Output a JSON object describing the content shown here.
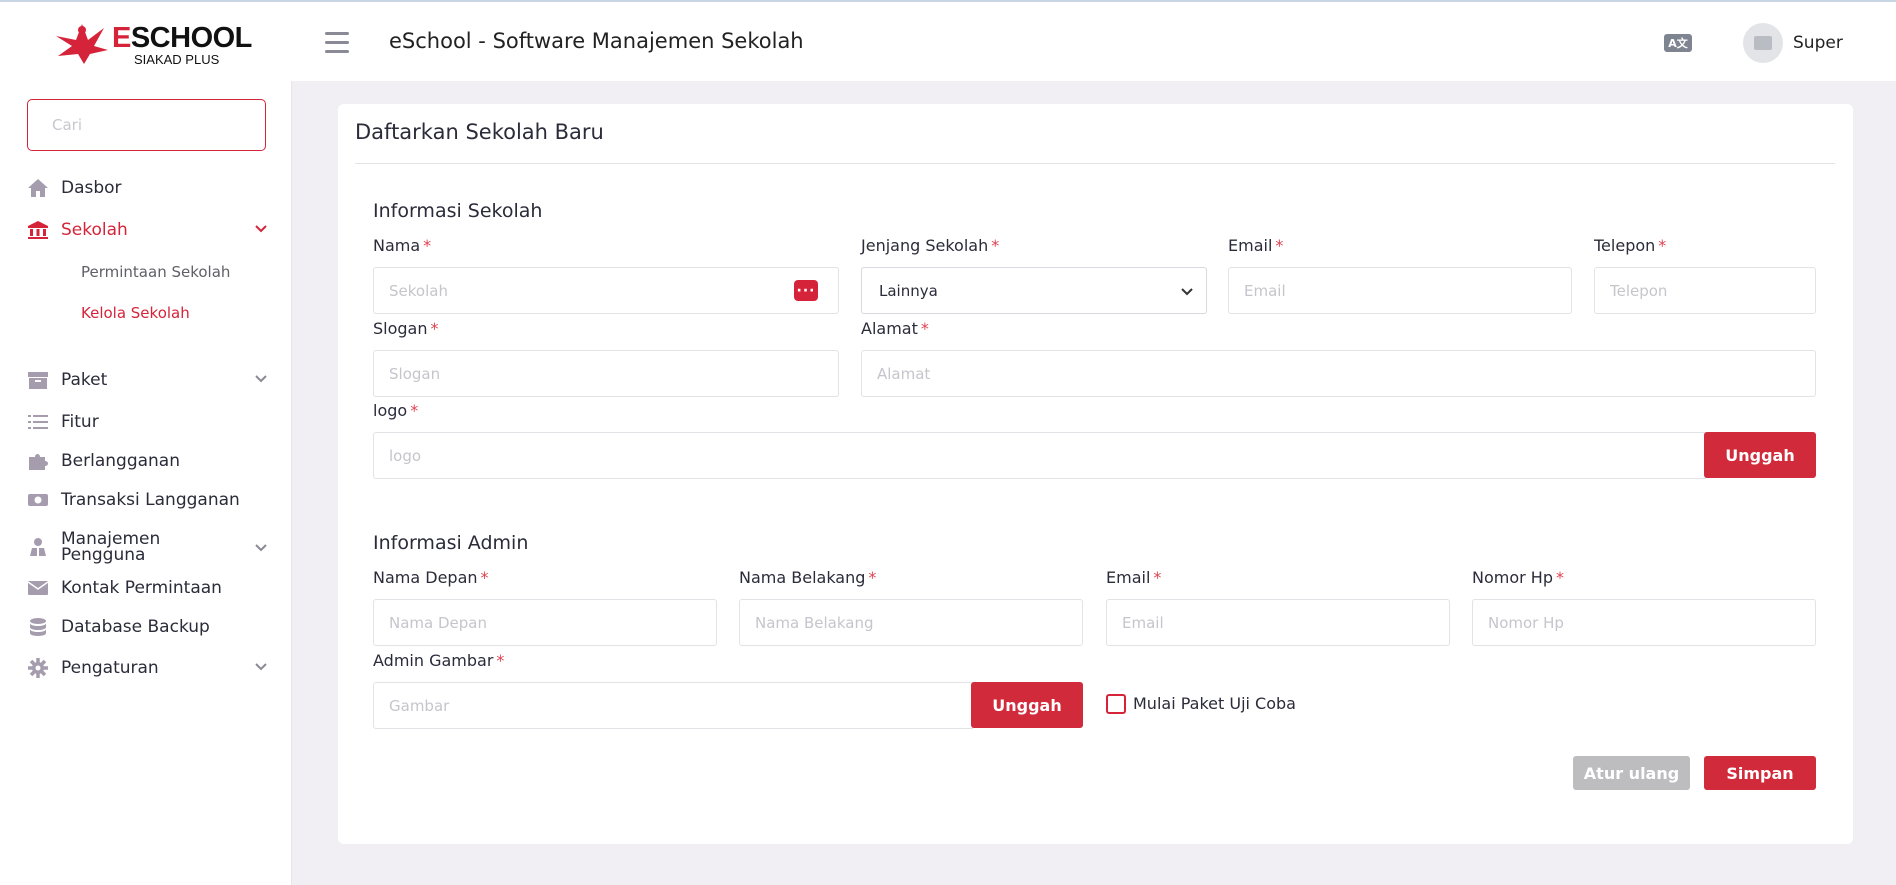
{
  "header": {
    "logo_main_e": "E",
    "logo_main_rest": "SCHOOL",
    "logo_sub": "SIAKAD PLUS",
    "app_title": "eSchool - Software Manajemen Sekolah",
    "lang_icon": "A文",
    "user_name": "Super"
  },
  "sidebar": {
    "search_placeholder": "Cari",
    "items": [
      {
        "label": "Dasbor",
        "icon": "home-icon"
      },
      {
        "label": "Sekolah",
        "icon": "bank-icon",
        "active": true,
        "expanded": true
      },
      {
        "label": "Paket",
        "icon": "archive-icon"
      },
      {
        "label": "Fitur",
        "icon": "list-icon"
      },
      {
        "label": "Berlangganan",
        "icon": "puzzle-icon"
      },
      {
        "label": "Transaksi Langganan",
        "icon": "money-icon"
      },
      {
        "label": "Manajemen Pengguna",
        "label_line1": "Manajemen",
        "label_line2": "Pengguna",
        "icon": "users-icon"
      },
      {
        "label": "Kontak Permintaan",
        "icon": "envelope-icon"
      },
      {
        "label": "Database Backup",
        "icon": "database-icon"
      },
      {
        "label": "Pengaturan",
        "icon": "gear-icon"
      }
    ],
    "sub_items": [
      {
        "label": "Permintaan Sekolah"
      },
      {
        "label": "Kelola Sekolah",
        "active": true
      }
    ]
  },
  "form": {
    "title": "Daftarkan Sekolah Baru",
    "school_section": "Informasi Sekolah",
    "name_label": "Nama",
    "name_placeholder": "Sekolah",
    "level_label": "Jenjang Sekolah",
    "level_value": "Lainnya",
    "email_label": "Email",
    "email_placeholder": "Email",
    "phone_label": "Telepon",
    "phone_placeholder": "Telepon",
    "slogan_label": "Slogan",
    "slogan_placeholder": "Slogan",
    "address_label": "Alamat",
    "address_placeholder": "Alamat",
    "logo_label": "logo",
    "logo_placeholder": "logo",
    "upload_label": "Unggah",
    "admin_section": "Informasi Admin",
    "first_name_label": "Nama Depan",
    "first_name_placeholder": "Nama Depan",
    "last_name_label": "Nama Belakang",
    "last_name_placeholder": "Nama Belakang",
    "admin_email_label": "Email",
    "admin_email_placeholder": "Email",
    "mobile_label": "Nomor Hp",
    "mobile_placeholder": "Nomor Hp",
    "admin_image_label": "Admin Gambar",
    "admin_image_placeholder": "Gambar",
    "admin_upload_label": "Unggah",
    "trial_label": "Mulai Paket Uji Coba",
    "required_mark": "*",
    "reset_label": "Atur ulang",
    "save_label": "Simpan"
  },
  "colors": {
    "accent": "#d5243a",
    "background": "#f1eff3",
    "reset_button": "#bdbdc0"
  }
}
